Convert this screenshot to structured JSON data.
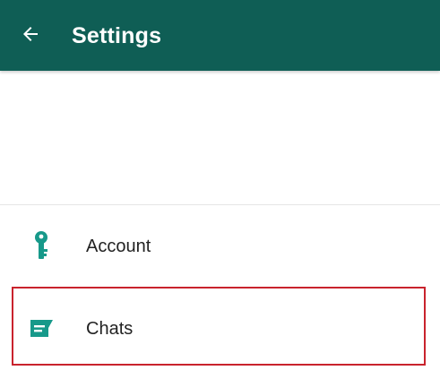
{
  "app_bar": {
    "title": "Settings",
    "back_icon": "arrow-left-icon",
    "background_color": "#0f5e55"
  },
  "settings": {
    "items": [
      {
        "label": "Account",
        "icon": "key-icon",
        "icon_color": "#17998a"
      },
      {
        "label": "Chats",
        "icon": "chat-icon",
        "icon_color": "#17998a"
      }
    ]
  },
  "highlight": {
    "target": "Chats",
    "color": "#c9232d"
  }
}
